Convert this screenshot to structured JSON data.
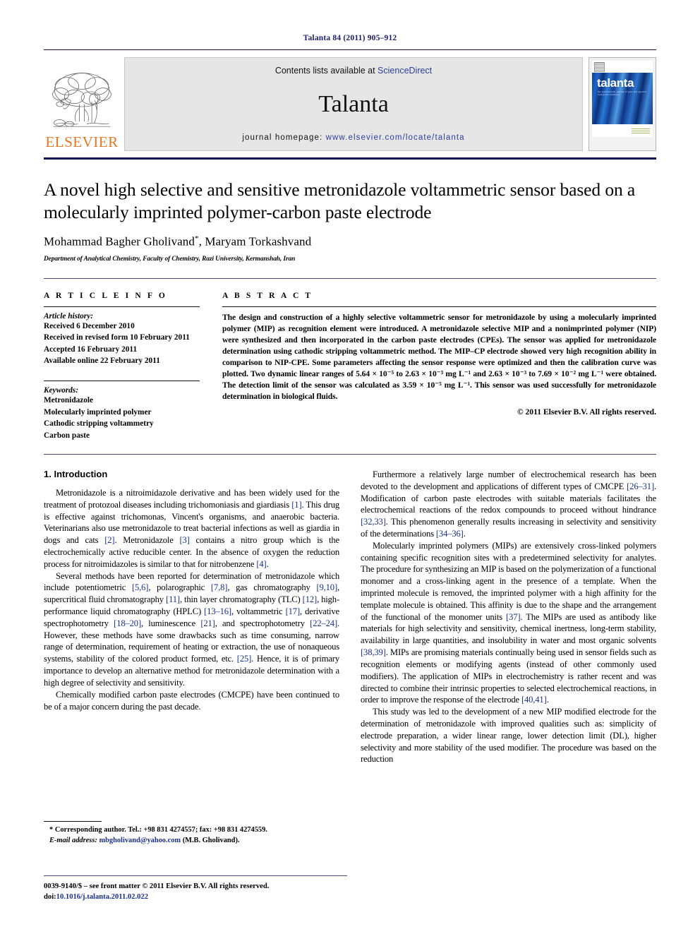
{
  "running_head": "Talanta 84 (2011) 905–912",
  "masthead": {
    "elsevier_wordmark": "ELSEVIER",
    "contents_prefix": "Contents lists available at ",
    "contents_link": "ScienceDirect",
    "journal_name": "Talanta",
    "homepage_prefix": "journal homepage: ",
    "homepage_url": "www.elsevier.com/locate/talanta",
    "cover_title": "talanta",
    "cover_subtitle": "the international journal of pure and applied analytical chemistry"
  },
  "article": {
    "title": "A novel high selective and sensitive metronidazole voltammetric sensor based on a molecularly imprinted polymer-carbon paste electrode",
    "authors": "Mohammad Bagher Gholivand",
    "author_mark": "*",
    "authors_rest": ", Maryam Torkashvand",
    "affiliation": "Department of Analytical Chemistry, Faculty of Chemistry, Razi University, Kermanshah, Iran"
  },
  "article_info": {
    "label": "A R T I C L E   I N F O",
    "history_label": "Article history:",
    "history": [
      "Received 6 December 2010",
      "Received in revised form 10 February 2011",
      "Accepted 16 February 2011",
      "Available online 22 February 2011"
    ],
    "keywords_label": "Keywords:",
    "keywords": [
      "Metronidazole",
      "Molecularly imprinted polymer",
      "Cathodic stripping voltammetry",
      "Carbon paste"
    ]
  },
  "abstract": {
    "label": "A B S T R A C T",
    "text": "The design and construction of a highly selective voltammetric sensor for metronidazole by using a molecularly imprinted polymer (MIP) as recognition element were introduced. A metronidazole selective MIP and a nonimprinted polymer (NIP) were synthesized and then incorporated in the carbon paste electrodes (CPEs). The sensor was applied for metronidazole determination using cathodic stripping voltammetric method. The MIP–CP electrode showed very high recognition ability in comparison to NIP-CPE. Some parameters affecting the sensor response were optimized and then the calibration curve was plotted. Two dynamic linear ranges of 5.64 × 10⁻⁵ to 2.63 × 10⁻³ mg L⁻¹ and 2.63 × 10⁻³ to 7.69 × 10⁻² mg L⁻¹ were obtained. The detection limit of the sensor was calculated as 3.59 × 10⁻⁵ mg L⁻¹. This sensor was used successfully for metronidazole determination in biological fluids.",
    "copyright": "© 2011 Elsevier B.V. All rights reserved."
  },
  "body": {
    "section_heading": "1.  Introduction",
    "left_paragraphs": [
      "Metronidazole is a nitroimidazole derivative and has been widely used for the treatment of protozoal diseases including trichomoniasis and giardiasis [1]. This drug is effective against trichomonas, Vincent's organisms, and anaerobic bacteria. Veterinarians also use metronidazole to treat bacterial infections as well as giardia in dogs and cats [2]. Metronidazole [3] contains a nitro group which is the electrochemically active reducible center. In the absence of oxygen the reduction process for nitroimidazoles is similar to that for nitrobenzene [4].",
      "Several methods have been reported for determination of metronidazole which include potentiometric [5,6], polarographic [7,8], gas chromatography [9,10], supercritical fluid chromatography [11], thin layer chromatography (TLC) [12], high-performance liquid chromatography (HPLC) [13–16], voltammetric [17], derivative spectrophotometry [18–20], luminescence [21], and spectrophotometry [22–24]. However, these methods have some drawbacks such as time consuming, narrow range of determination, requirement of heating or extraction, the use of nonaqueous systems, stability of the colored product formed, etc. [25]. Hence, it is of primary importance to develop an alternative method for metronidazole determination with a high degree of selectivity and sensitivity.",
      "Chemically modified carbon paste electrodes (CMCPE) have been continued to be of a major concern during the past decade."
    ],
    "right_paragraphs": [
      "Furthermore a relatively large number of electrochemical research has been devoted to the development and applications of different types of CMCPE [26–31]. Modification of carbon paste electrodes with suitable materials facilitates the electrochemical reactions of the redox compounds to proceed without hindrance [32,33]. This phenomenon generally results increasing in selectivity and sensitivity of the determinations [34–36].",
      "Molecularly imprinted polymers (MIPs) are extensively cross-linked polymers containing specific recognition sites with a predetermined selectivity for analytes. The procedure for synthesizing an MIP is based on the polymerization of a functional monomer and a cross-linking agent in the presence of a template. When the imprinted molecule is removed, the imprinted polymer with a high affinity for the template molecule is obtained. This affinity is due to the shape and the arrangement of the functional of the monomer units [37]. The MIPs are used as antibody like materials for high selectivity and sensitivity, chemical inertness, long-term stability, availability in large quantities, and insolubility in water and most organic solvents [38,39]. MIPs are promising materials continually being used in sensor fields such as recognition elements or modifying agents (instead of other commonly used modifiers). The application of MIPs in electrochemistry is rather recent and was directed to combine their intrinsic properties to selected electrochemical reactions, in order to improve the response of the electrode [40,41].",
      "This study was led to the development of a new MIP modified electrode for the determination of metronidazole with improved qualities such as: simplicity of electrode preparation, a wider linear range, lower detection limit (DL), higher selectivity and more stability of the used modifier. The procedure was based on the reduction"
    ]
  },
  "footnote": {
    "marker": "*",
    "corresponding": "Corresponding author. Tel.: +98 831 4274557; fax: +98 831 4274559.",
    "email_label": "E-mail address:",
    "email": "mbgholivand@yahoo.com",
    "email_owner": "(M.B. Gholivand)."
  },
  "page_footer": {
    "issn_line": "0039-9140/$ – see front matter © 2011 Elsevier B.V. All rights reserved.",
    "doi_label": "doi:",
    "doi": "10.1016/j.talanta.2011.02.022"
  },
  "colors": {
    "link_blue": "#2b3f9e",
    "ref_blue": "#1a2f8f",
    "rule_navy": "#12124e",
    "elsevier_orange": "#e87722"
  }
}
